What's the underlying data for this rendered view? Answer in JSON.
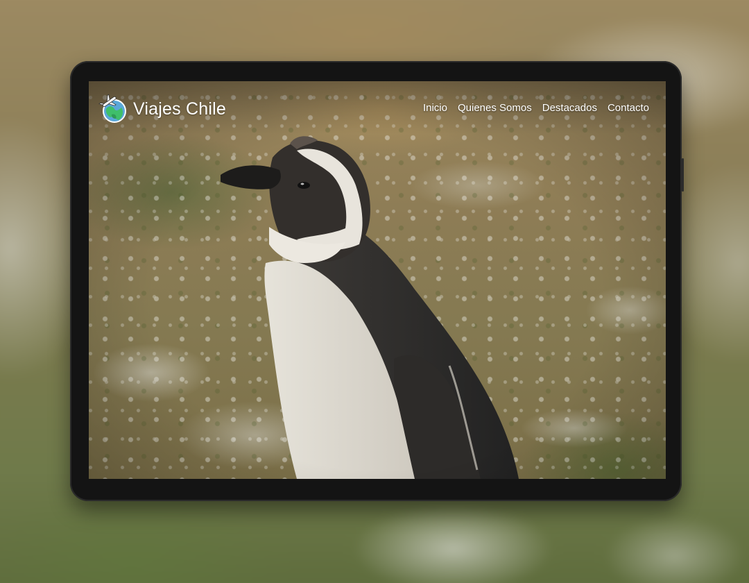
{
  "site": {
    "brand_name": "Viajes Chile",
    "logo_icon": "globe-airplane-logo-icon"
  },
  "nav": {
    "items": [
      {
        "label": "Inicio"
      },
      {
        "label": "Quienes Somos"
      },
      {
        "label": "Destacados"
      },
      {
        "label": "Contacto"
      }
    ]
  },
  "colors": {
    "nav_text": "#ffffff",
    "device_frame": "#141414",
    "logo_globe": "#3fbf6a",
    "logo_ocean": "#5aa7d8"
  },
  "hero": {
    "subject": "penguin-photo"
  }
}
